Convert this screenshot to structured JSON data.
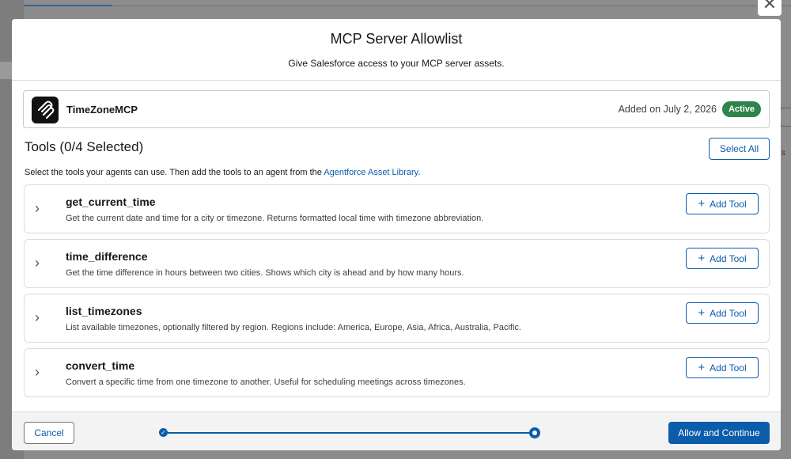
{
  "modal": {
    "title": "MCP Server Allowlist",
    "subtitle": "Give Salesforce access to your MCP server assets."
  },
  "server": {
    "name": "TimeZoneMCP",
    "added": "Added on July 2, 2026",
    "status": "Active",
    "status_color": "#2e844a",
    "logo_icon": "mcp-logo-icon"
  },
  "tools_section": {
    "title": "Tools (0/4 Selected)",
    "select_all_label": "Select All",
    "help_text": "Select the tools your agents can use. Then add the tools to an agent from the ",
    "help_link": "Agentforce Asset Library",
    "help_suffix": "."
  },
  "tools": [
    {
      "name": "get_current_time",
      "description": "Get the current date and time for a city or timezone. Returns formatted local time with timezone abbreviation.",
      "button": "Add Tool"
    },
    {
      "name": "time_difference",
      "description": "Get the time difference in hours between two cities. Shows which city is ahead and by how many hours.",
      "button": "Add Tool"
    },
    {
      "name": "list_timezones",
      "description": "List available timezones, optionally filtered by region. Regions include: America, Europe, Asia, Africa, Australia, Pacific.",
      "button": "Add Tool"
    },
    {
      "name": "convert_time",
      "description": "Convert a specific time from one timezone to another. Useful for scheduling meetings across timezones.",
      "button": "Add Tool"
    }
  ],
  "footer": {
    "cancel_label": "Cancel",
    "continue_label": "Allow and Continue",
    "progress_steps": 2,
    "current_step": 2
  },
  "colors": {
    "brand": "#0b5cab",
    "active_badge": "#2e844a"
  },
  "background": {
    "right_text": "s"
  }
}
